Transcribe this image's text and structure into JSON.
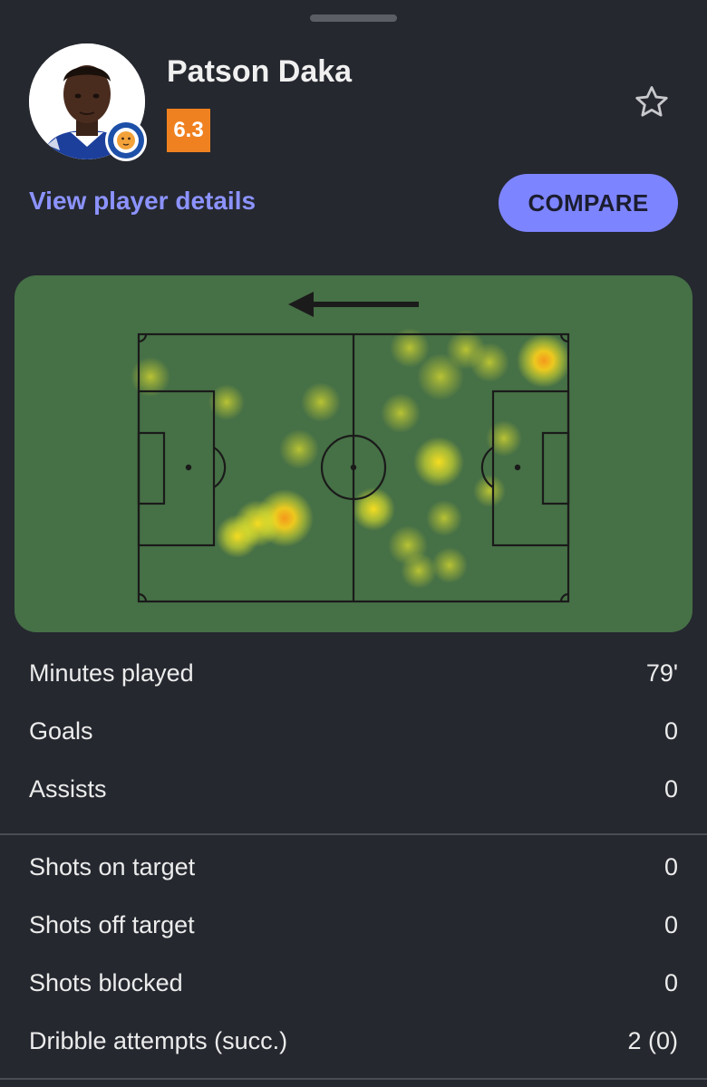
{
  "player": {
    "name": "Patson Daka",
    "rating": "6.3",
    "details_link": "View player details",
    "compare_label": "COMPARE"
  },
  "colors": {
    "rating_badge": "#f08120",
    "accent": "#7d84ff",
    "link": "#8c93ff",
    "pitch": "#467046",
    "background": "#25282f"
  },
  "heatmap": {
    "attack_direction": "left"
  },
  "stats_group_1": [
    {
      "label": "Minutes played",
      "value": "79'"
    },
    {
      "label": "Goals",
      "value": "0"
    },
    {
      "label": "Assists",
      "value": "0"
    }
  ],
  "stats_group_2": [
    {
      "label": "Shots on target",
      "value": "0"
    },
    {
      "label": "Shots off target",
      "value": "0"
    },
    {
      "label": "Shots blocked",
      "value": "0"
    },
    {
      "label": "Dribble attempts (succ.)",
      "value": "2 (0)"
    }
  ],
  "icons": {
    "favorite": "star-outline-icon",
    "direction": "arrow-left-icon",
    "club": "leicester-city-crest"
  }
}
